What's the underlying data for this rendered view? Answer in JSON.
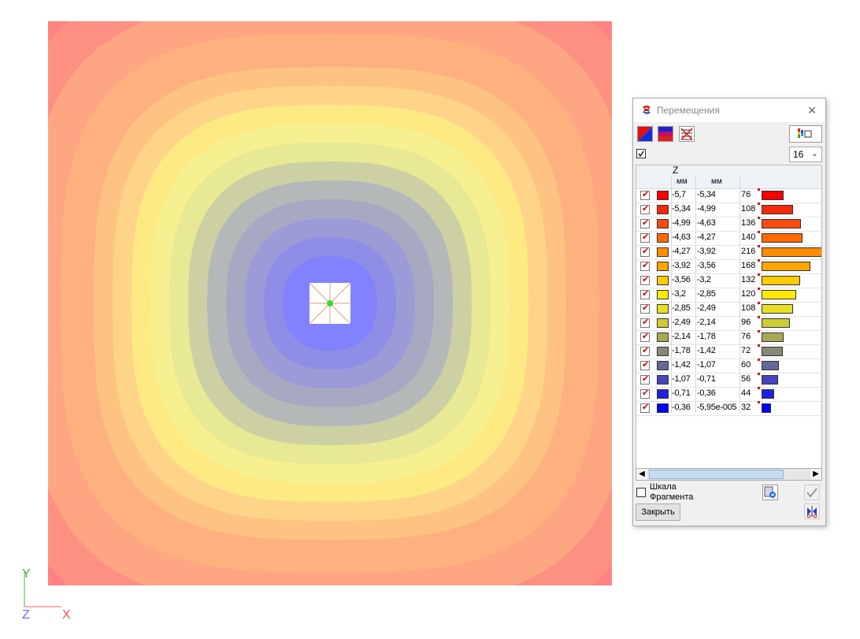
{
  "plot": {
    "colors": [
      "#fe8282",
      "#fe9082",
      "#fea682",
      "#feb07f",
      "#fec282",
      "#fed588",
      "#feea82",
      "#f7f090",
      "#e8e994",
      "#ccd0a3",
      "#b5b8b8",
      "#a8a8c3",
      "#9b9bd8",
      "#8e8ee7",
      "#8282fe"
    ]
  },
  "axes": {
    "y": "Y",
    "z": "Z",
    "x": "X"
  },
  "dialog": {
    "title": "Перемещения",
    "close_icon": "close-icon",
    "count_value": "16",
    "header": {
      "component": "Z",
      "unit_from": "мм",
      "unit_to": "мм"
    },
    "rows": [
      {
        "from": "-5,7",
        "to": "-5,34",
        "count": "76",
        "color": "#ff0000"
      },
      {
        "from": "-5,34",
        "to": "-4,99",
        "count": "108",
        "color": "#f52a0a"
      },
      {
        "from": "-4,99",
        "to": "-4,63",
        "count": "136",
        "color": "#fa4b10"
      },
      {
        "from": "-4,63",
        "to": "-4,27",
        "count": "140",
        "color": "#ff6a00"
      },
      {
        "from": "-4,27",
        "to": "-3,92",
        "count": "216",
        "color": "#ff8c00"
      },
      {
        "from": "-3,92",
        "to": "-3,56",
        "count": "168",
        "color": "#ffa500"
      },
      {
        "from": "-3,56",
        "to": "-3,2",
        "count": "132",
        "color": "#ffcc00"
      },
      {
        "from": "-3,2",
        "to": "-2,85",
        "count": "120",
        "color": "#ffea00"
      },
      {
        "from": "-2,85",
        "to": "-2,49",
        "count": "108",
        "color": "#e8e020"
      },
      {
        "from": "-2,49",
        "to": "-2,14",
        "count": "96",
        "color": "#cccc33"
      },
      {
        "from": "-2,14",
        "to": "-1,78",
        "count": "76",
        "color": "#aaaa55"
      },
      {
        "from": "-1,78",
        "to": "-1,42",
        "count": "72",
        "color": "#888877"
      },
      {
        "from": "-1,42",
        "to": "-1,07",
        "count": "60",
        "color": "#666699"
      },
      {
        "from": "-1,07",
        "to": "-0,71",
        "count": "56",
        "color": "#4444bb"
      },
      {
        "from": "-0,71",
        "to": "-0,36",
        "count": "44",
        "color": "#2222dd"
      },
      {
        "from": "-0,36",
        "to": "-5,95e-005",
        "count": "32",
        "color": "#0000ff"
      }
    ],
    "scale_label": "Шкала",
    "fragment_label": "Фрагмента",
    "close_label": "Закрыть"
  }
}
